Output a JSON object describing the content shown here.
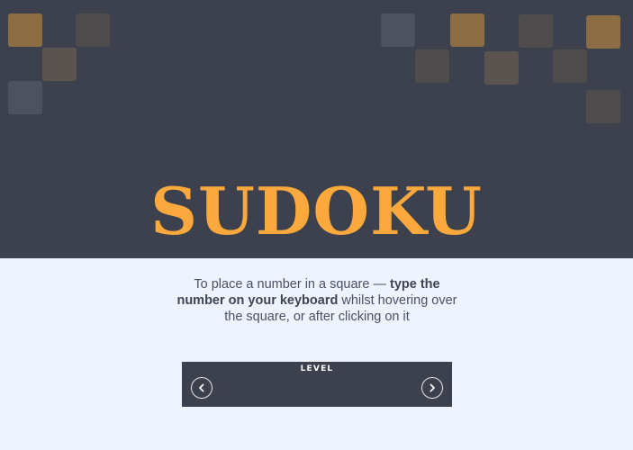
{
  "app": {
    "title": "SUDOKU"
  },
  "instructions": {
    "part1": "To place a number in a square — ",
    "bold": "type the number on your keyboard",
    "part2": " whilst hovering over the square, or after clicking on it"
  },
  "level": {
    "label": "LEVEL",
    "prev_icon": "chevron-left-icon",
    "next_icon": "chevron-right-icon"
  },
  "colors": {
    "hero_bg": "#3c414d",
    "accent": "#fba83d",
    "page_bg": "#eff3ff"
  }
}
